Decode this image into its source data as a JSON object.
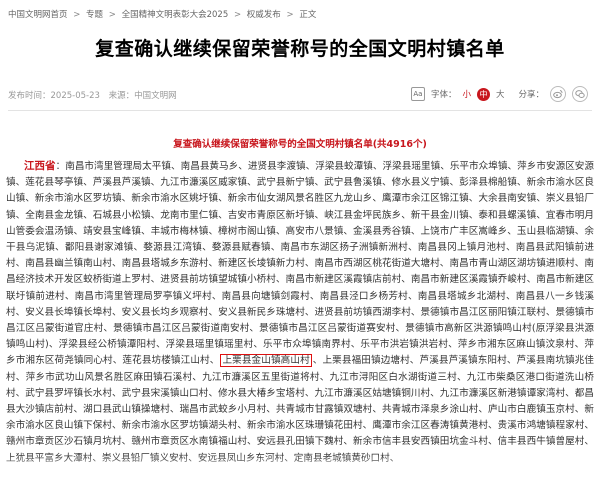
{
  "breadcrumb": {
    "items": [
      "中国文明网首页",
      "专题",
      "全国精神文明表彰大会2025",
      "权威发布",
      "正文"
    ],
    "separator": ">"
  },
  "article": {
    "title": "复查确认继续保留荣誉称号的全国文明村镇名单",
    "publish_time": "发布时间：2025-05-23",
    "source": "来源：中国文明网",
    "font_size_label": "字体：",
    "font_sizes": [
      "小",
      "中",
      "大"
    ],
    "share_label": "分享："
  },
  "list": {
    "heading": "复查确认继续保留荣誉称号的全国文明村镇名单(共4916个)",
    "province": "江西省",
    "text_before": "南昌市湾里管理局太平镇、南昌县黄马乡、进贤县李渡镇、浮梁县蛟潭镇、浮梁县瑶里镇、乐平市众埠镇、萍乡市安源区安源镇、莲花县琴亭镇、芦溪县芦溪镇、九江市濂溪区威家镇、武宁县新宁镇、武宁县鲁溪镇、修水县义宁镇、彭泽县棉船镇、新余市渝水区良山镇、新余市渝水区罗坊镇、新余市渝水区姚圩镇、新余市仙女湖风景名胜区九龙山乡、鹰潭市余江区锦江镇、大余县南安镇、崇义县铅厂镇、全南县金龙镇、石城县小松镇、龙南市里仁镇、吉安市青原区新圩镇、峡江县金坪民族乡、新干县金川镇、泰和县螺溪镇、宜春市明月山管委会温汤镇、靖安县宝峰镇、丰城市梅林镇、樟树市阁山镇、高安市八景镇、金溪县秀谷镇、上饶市广丰区嵩峰乡、玉山县临湖镇、余干县乌泥镇、鄱阳县谢家滩镇、婺源县江湾镇、婺源县赋春镇、南昌市东湖区扬子洲镇新洲村、南昌县冈上镇月池村、南昌县武阳镇前进村、南昌县幽兰镇南山村、南昌县塔城乡东游村、新建区长堎镇新力村、南昌市西湖区桃花街道大塘村、南昌市青山湖区湖坊镇进顺村、南昌经济技术开发区蛟桥街道上罗村、进贤县前坊镇望城镇小桥村、南昌市新建区溪霞镇店前村、南昌市新建区溪霞镇乔峻村、南昌市新建区联圩镇前进村、南昌市湾里管理局罗亭镇义坪村、南昌县向塘镇剑霞村、南昌县泾口乡杨芳村、南昌县塔城乡北湖村、南昌县八一乡钱溪村、安义县长埠镇长埠村、安义县长均乡观察村、安义县新民乡珠塘村、进贤县前坊镇西湖李村、景德镇市昌江区丽阳镇江联村、景德镇市昌江区吕蒙街道官庄村、景德镇市昌江区吕蒙街道南安村、景德镇市昌江区吕蒙街道赛安村、景德镇市高新区洪源镇鸣山村(原浮梁县洪源镇鸣山村)、浮梁县经公桥镇潭阳村、浮梁县瑶里镇瑶里村、乐平市众埠镇南界村、乐平市洪岩镇洪岩村、萍乡市湘东区麻山镇汶泉村、萍乡市湘东区荷尧镇同心村、莲花县坊楼镇江山村、",
    "highlighted": "上栗县金山镇高山村",
    "text_after": "、上栗县福田镇边塘村、芦溪县芦溪镇东阳村、芦溪县南坑镇兆佳村、萍乡市武功山风景名胜区麻田镇石溪村、九江市濂溪区五里街道将村、九江市浔阳区白水湖街道三村、九江市柴桑区港口街道洗山桥村、武宁县罗坪镇长水村、武宁县宋溪镇山口村、修水县大椿乡宝塔村、九江市濂溪区姑塘镇铜川村、九江市濂溪区新港镇谭家湾村、都昌县大沙镇店前村、湖口县武山镇操塘村、瑞昌市武蛟乡小月村、共青城市甘露镇双塘村、共青城市泽泉乡涂山村、庐山市白鹿镇玉京村、新余市渝水区良山镇下保村、新余市渝水区罗坊镇湖头村、新余市渝水区珠珊镇花田村、鹰潭市余江区春涛镇黄港村、贵溪市鸿塘镇程家村、赣州市章贡区沙石镇月坑村、赣州市章贡区水南镇福山村、安远县孔田镇下魏村、新余市信丰县安西镇田坑金斗村、信丰县西牛镇曾屋村、上犹县平富乡大潭村、崇义县铅厂镇义安村、安远县凤山乡东河村、定南县老城镇黄砂口村、"
  }
}
